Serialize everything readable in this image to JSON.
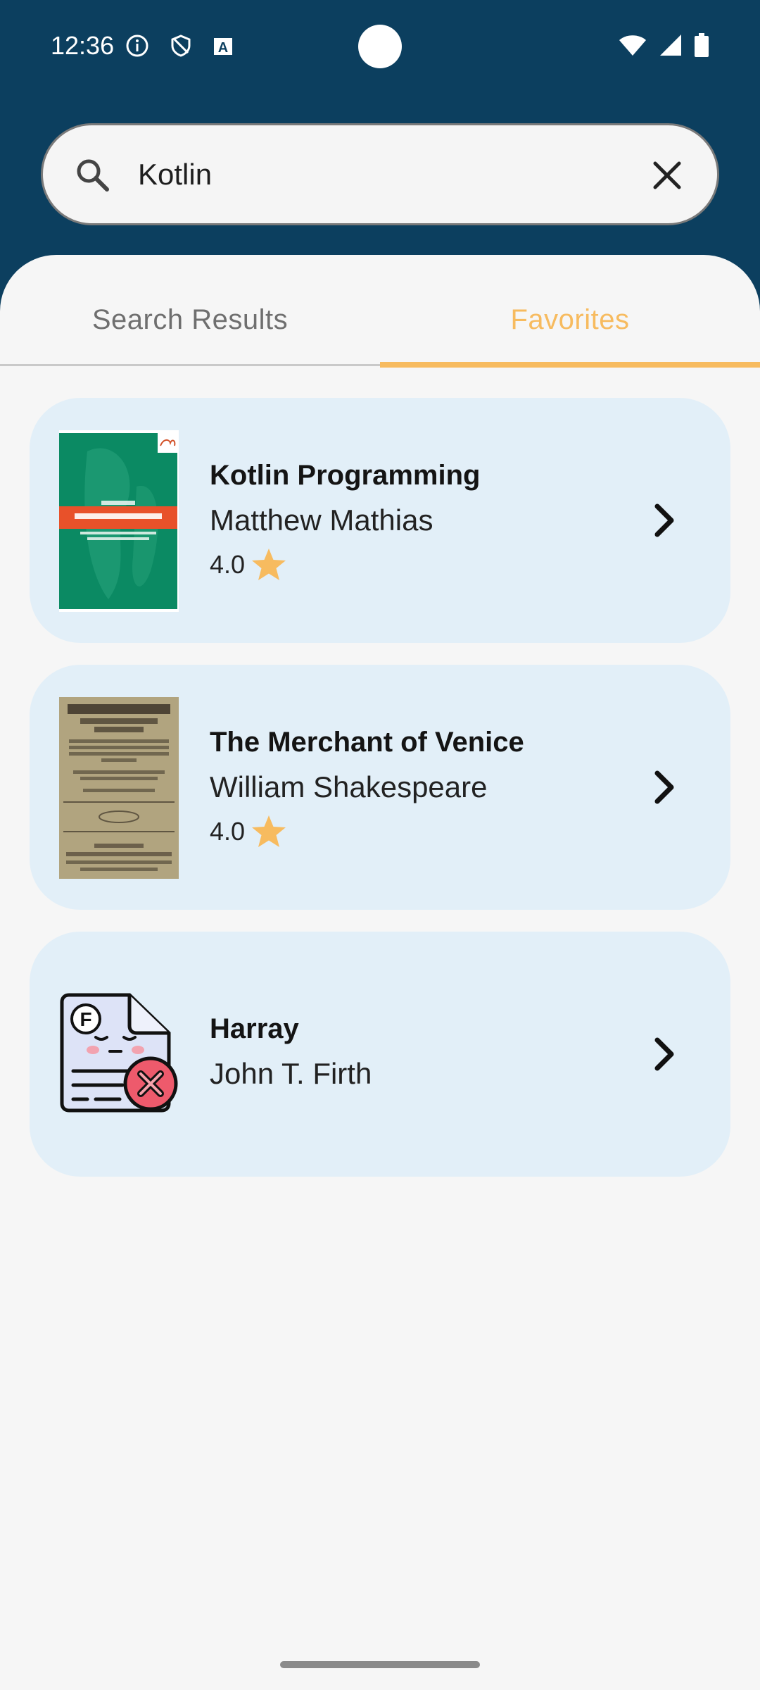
{
  "status": {
    "time": "12:36",
    "left_icons": [
      "info-icon",
      "shield-icon",
      "a-badge-icon"
    ],
    "right_icons": [
      "wifi-icon",
      "signal-icon",
      "battery-icon"
    ]
  },
  "search": {
    "icon": "search-icon",
    "value": "Kotlin",
    "clear_icon": "close-icon"
  },
  "tabs": [
    {
      "label": "Search Results",
      "selected": false
    },
    {
      "label": "Favorites",
      "selected": true
    }
  ],
  "books": [
    {
      "title": "Kotlin Programming",
      "author": "Matthew Mathias",
      "rating": "4.0",
      "cover": "kotlin-cover"
    },
    {
      "title": "The Merchant of Venice",
      "author": "William Shakespeare",
      "rating": "4.0",
      "cover": "merchant-cover"
    },
    {
      "title": "Harray",
      "author": "John T. Firth",
      "cover": "missing-file-icon"
    }
  ],
  "colors": {
    "header": "#0c3f5f",
    "accent": "#f7bb5f",
    "card": "#e2eff8",
    "background": "#f6f6f6"
  }
}
